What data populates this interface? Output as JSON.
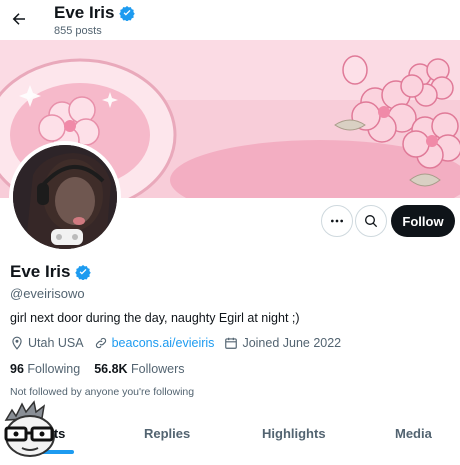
{
  "header": {
    "name": "Eve Iris",
    "posts_count": "855 posts"
  },
  "profile": {
    "name": "Eve Iris",
    "handle": "@eveirisowo",
    "bio": "girl next door during the day, naughty Egirl at night ;)",
    "location": "Utah USA",
    "website": "beacons.ai/evieiris",
    "joined": "Joined June 2022",
    "following_count": "96",
    "following_label": "Following",
    "followers_count": "56.8K",
    "followers_label": "Followers",
    "not_followed_note": "Not followed by anyone you're following"
  },
  "actions": {
    "follow_label": "Follow"
  },
  "tabs": [
    {
      "label": "Posts"
    },
    {
      "label": "Replies"
    },
    {
      "label": "Highlights"
    },
    {
      "label": "Media"
    }
  ],
  "colors": {
    "accent": "#1d9bf0",
    "follow_bg": "#0f1419",
    "banner_pink": "#f7c9d6"
  },
  "icons": {
    "back": "arrow-left-icon",
    "verified": "verified-badge-icon",
    "more": "more-horizontal-icon",
    "search": "search-icon",
    "location": "location-pin-icon",
    "link": "link-icon",
    "calendar": "calendar-icon"
  }
}
